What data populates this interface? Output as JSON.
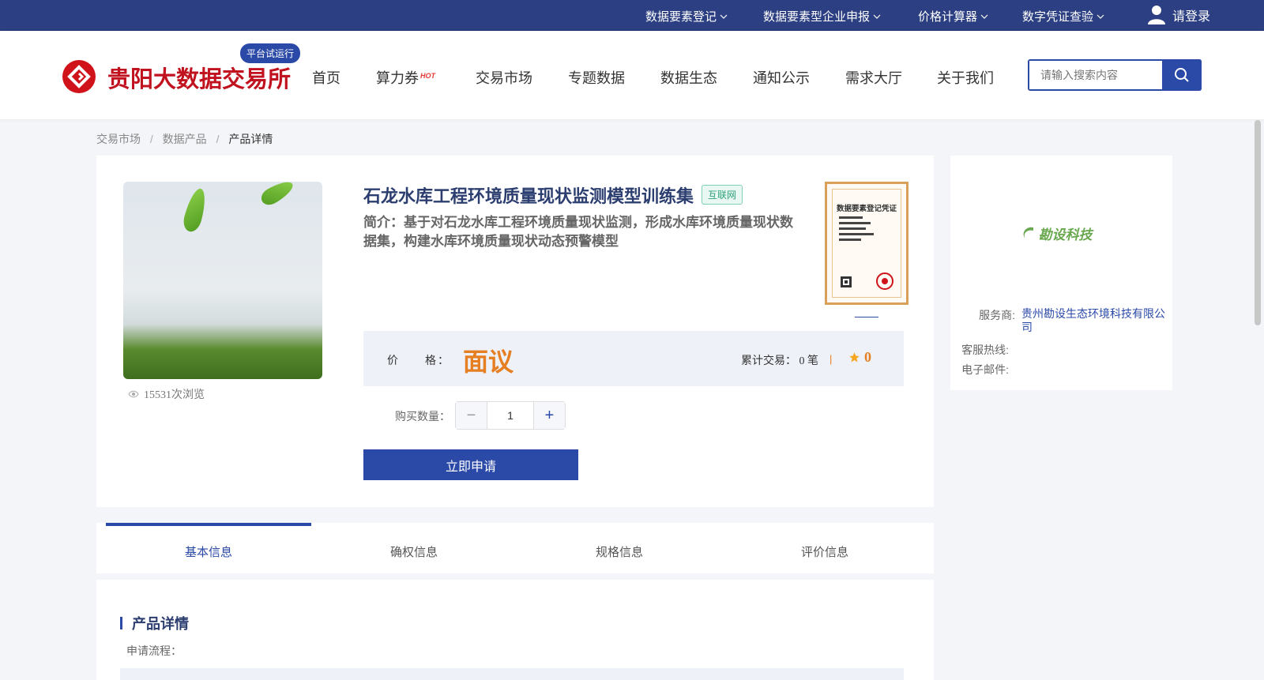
{
  "topbar": {
    "items": [
      {
        "label": "数据要素登记"
      },
      {
        "label": "数据要素型企业申报"
      },
      {
        "label": "价格计算器"
      },
      {
        "label": "数字凭证查验"
      }
    ],
    "login_label": "请登录"
  },
  "header": {
    "logo_text": "贵阳大数据交易所",
    "pilot_badge": "平台试运行",
    "nav": [
      {
        "label": "首页"
      },
      {
        "label": "算力券",
        "badge": "HOT"
      },
      {
        "label": "交易市场"
      },
      {
        "label": "专题数据"
      },
      {
        "label": "数据生态"
      },
      {
        "label": "通知公示"
      },
      {
        "label": "需求大厅"
      },
      {
        "label": "关于我们"
      }
    ],
    "search_placeholder": "请输入搜索内容"
  },
  "breadcrumb": {
    "items": [
      "交易市场",
      "数据产品",
      "产品详情"
    ],
    "separator": "/"
  },
  "product": {
    "title": "石龙水库工程环境质量现状监测模型训练集",
    "tag": "互联网",
    "intro": "简介：基于对石龙水库工程环境质量现状监测，形成水库环境质量现状数据集，构建水库环境质量现状动态预警模型",
    "views": "15531次浏览",
    "certificate_title": "数据要素登记凭证",
    "price_label": "价　　格：",
    "price_value": "面议",
    "trade_count": "累计交易： 0 笔",
    "divider": "|",
    "rating": "0",
    "qty_label": "购买数量：",
    "qty_value": "1",
    "qty_minus": "−",
    "qty_plus": "+",
    "apply_button": "立即申请"
  },
  "provider": {
    "logo_text": "勘设科技",
    "service_label": "服务商:",
    "service_value": "贵州勘设生态环境科技有限公司",
    "hotline_label": "客服热线:",
    "hotline_value": "",
    "email_label": "电子邮件:",
    "email_value": ""
  },
  "tabs": [
    {
      "label": "基本信息",
      "active": true
    },
    {
      "label": "确权信息",
      "active": false
    },
    {
      "label": "规格信息",
      "active": false
    },
    {
      "label": "评价信息",
      "active": false
    }
  ],
  "details": {
    "section_title": "产品详情",
    "apply_flow_label": "申请流程："
  },
  "colors": {
    "primary": "#2b4aa8",
    "topbar": "#2b3f82",
    "brand_red": "#c1121f",
    "price_orange": "#e67e22",
    "tag_green": "#2ea17c"
  },
  "icons": [
    "chevron-down-icon",
    "user-icon",
    "search-icon",
    "eye-icon",
    "star-icon",
    "logo-icon"
  ]
}
